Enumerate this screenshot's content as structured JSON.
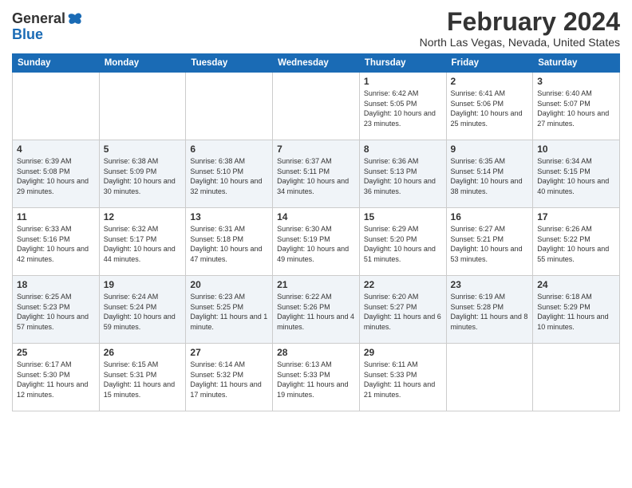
{
  "app": {
    "name_general": "General",
    "name_blue": "Blue"
  },
  "header": {
    "title": "February 2024",
    "location": "North Las Vegas, Nevada, United States"
  },
  "days_of_week": [
    "Sunday",
    "Monday",
    "Tuesday",
    "Wednesday",
    "Thursday",
    "Friday",
    "Saturday"
  ],
  "weeks": [
    {
      "days": [
        {
          "number": "",
          "empty": true
        },
        {
          "number": "",
          "empty": true
        },
        {
          "number": "",
          "empty": true
        },
        {
          "number": "",
          "empty": true
        },
        {
          "number": "1",
          "sunrise": "6:42 AM",
          "sunset": "5:05 PM",
          "daylight": "10 hours and 23 minutes."
        },
        {
          "number": "2",
          "sunrise": "6:41 AM",
          "sunset": "5:06 PM",
          "daylight": "10 hours and 25 minutes."
        },
        {
          "number": "3",
          "sunrise": "6:40 AM",
          "sunset": "5:07 PM",
          "daylight": "10 hours and 27 minutes."
        }
      ]
    },
    {
      "days": [
        {
          "number": "4",
          "sunrise": "6:39 AM",
          "sunset": "5:08 PM",
          "daylight": "10 hours and 29 minutes."
        },
        {
          "number": "5",
          "sunrise": "6:38 AM",
          "sunset": "5:09 PM",
          "daylight": "10 hours and 30 minutes."
        },
        {
          "number": "6",
          "sunrise": "6:38 AM",
          "sunset": "5:10 PM",
          "daylight": "10 hours and 32 minutes."
        },
        {
          "number": "7",
          "sunrise": "6:37 AM",
          "sunset": "5:11 PM",
          "daylight": "10 hours and 34 minutes."
        },
        {
          "number": "8",
          "sunrise": "6:36 AM",
          "sunset": "5:13 PM",
          "daylight": "10 hours and 36 minutes."
        },
        {
          "number": "9",
          "sunrise": "6:35 AM",
          "sunset": "5:14 PM",
          "daylight": "10 hours and 38 minutes."
        },
        {
          "number": "10",
          "sunrise": "6:34 AM",
          "sunset": "5:15 PM",
          "daylight": "10 hours and 40 minutes."
        }
      ]
    },
    {
      "days": [
        {
          "number": "11",
          "sunrise": "6:33 AM",
          "sunset": "5:16 PM",
          "daylight": "10 hours and 42 minutes."
        },
        {
          "number": "12",
          "sunrise": "6:32 AM",
          "sunset": "5:17 PM",
          "daylight": "10 hours and 44 minutes."
        },
        {
          "number": "13",
          "sunrise": "6:31 AM",
          "sunset": "5:18 PM",
          "daylight": "10 hours and 47 minutes."
        },
        {
          "number": "14",
          "sunrise": "6:30 AM",
          "sunset": "5:19 PM",
          "daylight": "10 hours and 49 minutes."
        },
        {
          "number": "15",
          "sunrise": "6:29 AM",
          "sunset": "5:20 PM",
          "daylight": "10 hours and 51 minutes."
        },
        {
          "number": "16",
          "sunrise": "6:27 AM",
          "sunset": "5:21 PM",
          "daylight": "10 hours and 53 minutes."
        },
        {
          "number": "17",
          "sunrise": "6:26 AM",
          "sunset": "5:22 PM",
          "daylight": "10 hours and 55 minutes."
        }
      ]
    },
    {
      "days": [
        {
          "number": "18",
          "sunrise": "6:25 AM",
          "sunset": "5:23 PM",
          "daylight": "10 hours and 57 minutes."
        },
        {
          "number": "19",
          "sunrise": "6:24 AM",
          "sunset": "5:24 PM",
          "daylight": "10 hours and 59 minutes."
        },
        {
          "number": "20",
          "sunrise": "6:23 AM",
          "sunset": "5:25 PM",
          "daylight": "11 hours and 1 minute."
        },
        {
          "number": "21",
          "sunrise": "6:22 AM",
          "sunset": "5:26 PM",
          "daylight": "11 hours and 4 minutes."
        },
        {
          "number": "22",
          "sunrise": "6:20 AM",
          "sunset": "5:27 PM",
          "daylight": "11 hours and 6 minutes."
        },
        {
          "number": "23",
          "sunrise": "6:19 AM",
          "sunset": "5:28 PM",
          "daylight": "11 hours and 8 minutes."
        },
        {
          "number": "24",
          "sunrise": "6:18 AM",
          "sunset": "5:29 PM",
          "daylight": "11 hours and 10 minutes."
        }
      ]
    },
    {
      "days": [
        {
          "number": "25",
          "sunrise": "6:17 AM",
          "sunset": "5:30 PM",
          "daylight": "11 hours and 12 minutes."
        },
        {
          "number": "26",
          "sunrise": "6:15 AM",
          "sunset": "5:31 PM",
          "daylight": "11 hours and 15 minutes."
        },
        {
          "number": "27",
          "sunrise": "6:14 AM",
          "sunset": "5:32 PM",
          "daylight": "11 hours and 17 minutes."
        },
        {
          "number": "28",
          "sunrise": "6:13 AM",
          "sunset": "5:33 PM",
          "daylight": "11 hours and 19 minutes."
        },
        {
          "number": "29",
          "sunrise": "6:11 AM",
          "sunset": "5:33 PM",
          "daylight": "11 hours and 21 minutes."
        },
        {
          "number": "",
          "empty": true
        },
        {
          "number": "",
          "empty": true
        }
      ]
    }
  ]
}
